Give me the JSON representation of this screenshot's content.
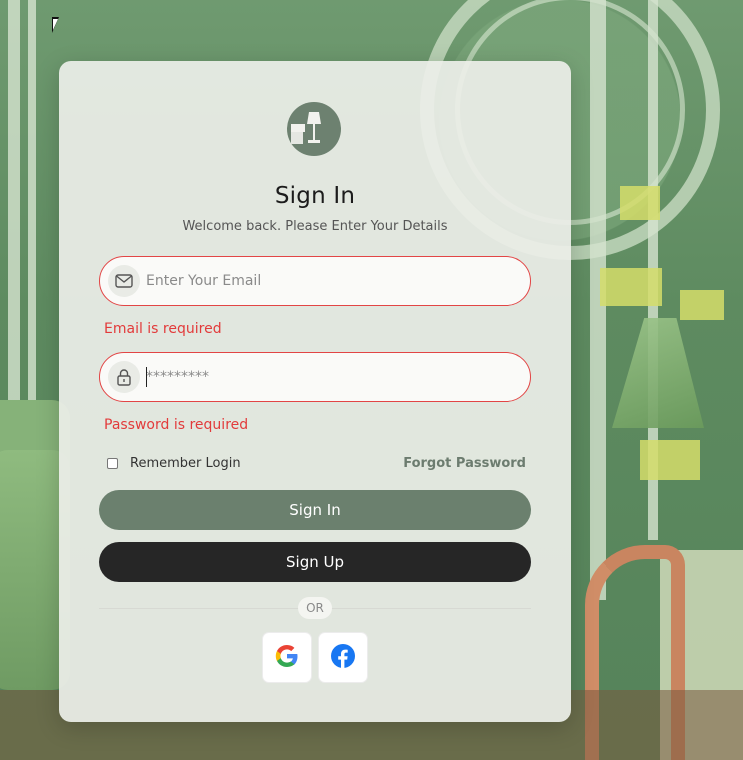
{
  "signin_card": {
    "title": "Sign In",
    "subtitle": "Welcome back. Please Enter Your Details",
    "email": {
      "placeholder": "Enter Your Email",
      "error": "Email is required",
      "icon": "mail-icon"
    },
    "password": {
      "placeholder": "*********",
      "error": "Password is required",
      "icon": "lock-icon"
    },
    "remember_label": "Remember Login",
    "forgot_label": "Forgot Password",
    "signin_button": "Sign In",
    "signup_button": "Sign Up",
    "divider_text": "OR",
    "social": [
      {
        "icon": "google-icon"
      },
      {
        "icon": "facebook-icon"
      }
    ]
  },
  "colors": {
    "error": "#e23b3b",
    "primary_button": "#6b806e",
    "secondary_button": "#262626",
    "card": "#eceee8"
  }
}
